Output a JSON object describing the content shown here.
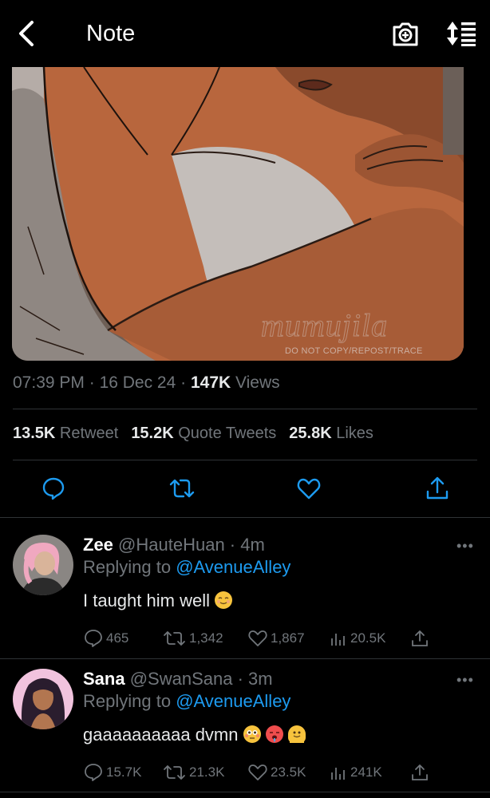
{
  "header": {
    "title": "Note",
    "back_icon": "chevron-left-icon",
    "camera_icon": "camera-plus-icon",
    "sort_icon": "sort-list-icon"
  },
  "media": {
    "watermark_small": "DO NOT COPY/REPOST/TRACE",
    "watermark_large": "mumujila"
  },
  "tweet_meta": {
    "time": "07:39 PM",
    "sep1": " · ",
    "date": "16 Dec 24",
    "sep2": " · ",
    "views_count": "147K",
    "views_label": " Views"
  },
  "stats": {
    "retweets_count": "13.5K",
    "retweets_label": " Retweet",
    "quotes_count": "15.2K",
    "quotes_label": " Quote Tweets",
    "likes_count": "25.8K",
    "likes_label": " Likes"
  },
  "replies": [
    {
      "name": "Zee",
      "handle": "@HauteHuan",
      "time": " · 4m",
      "replying_prefix": "Replying to ",
      "replying_to": "@AvenueAlley",
      "text": "I taught him well",
      "emojis": [
        "relieved-face"
      ],
      "counts": {
        "replies": "465",
        "retweets": "1,342",
        "likes": "1,867",
        "views": "20.5K"
      }
    },
    {
      "name": "Sana",
      "handle": "@SwanSana",
      "time": " · 3m",
      "replying_prefix": "Replying to ",
      "replying_to": "@AvenueAlley",
      "text": "gaaaaaaaaaa dvmn",
      "emojis": [
        "flushed-face",
        "hot-face",
        "melting-face"
      ],
      "counts": {
        "replies": "15.7K",
        "retweets": "21.3K",
        "likes": "23.5K",
        "views": "241K"
      }
    }
  ],
  "more_label": "•••",
  "colors": {
    "background": "#000000",
    "text": "#e7e9ea",
    "muted": "#71767b",
    "link": "#1d9bf0",
    "divider": "#2f3336"
  }
}
